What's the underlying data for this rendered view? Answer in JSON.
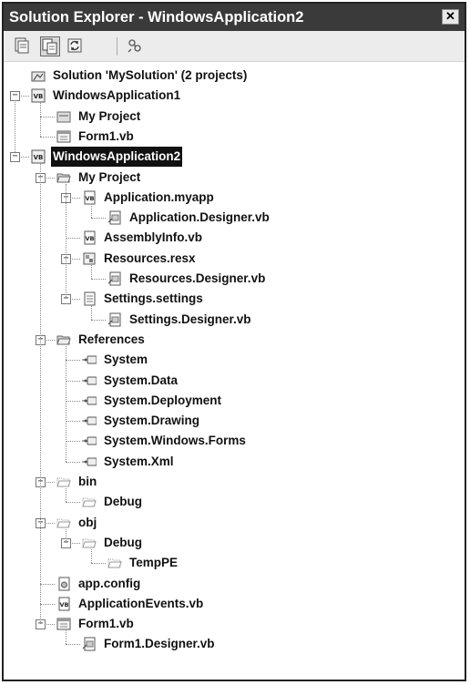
{
  "window": {
    "title": "Solution Explorer - WindowsApplication2",
    "close_glyph": "✕"
  },
  "toolbar": {
    "buttons": [
      {
        "name": "properties-button",
        "icon": "properties-icon",
        "active": false
      },
      {
        "name": "show-all-files-button",
        "icon": "show-all-files-icon",
        "active": true
      },
      {
        "name": "refresh-button",
        "icon": "refresh-icon",
        "active": false
      },
      {
        "name": "view-class-diagram-button",
        "icon": "class-diagram-icon",
        "active": false
      }
    ]
  },
  "tree": [
    {
      "label": "Solution 'MySolution' (2 projects)",
      "depth": 0,
      "icon": "solution-icon",
      "expander": "",
      "last": true
    },
    {
      "label": "WindowsApplication1",
      "depth": 0,
      "icon": "vb-project-icon",
      "expander": "-",
      "last": false
    },
    {
      "label": "My Project",
      "depth": 1,
      "icon": "my-project-icon",
      "expander": "",
      "last": false
    },
    {
      "label": "Form1.vb",
      "depth": 1,
      "icon": "form-icon",
      "expander": "",
      "last": true
    },
    {
      "label": "WindowsApplication2",
      "depth": 0,
      "icon": "vb-project-icon",
      "expander": "-",
      "last": true,
      "selected": true
    },
    {
      "label": "My Project",
      "depth": 1,
      "icon": "folder-open-icon",
      "expander": "-",
      "last": false
    },
    {
      "label": "Application.myapp",
      "depth": 2,
      "icon": "vb-file-icon",
      "expander": "-",
      "last": false
    },
    {
      "label": "Application.Designer.vb",
      "depth": 3,
      "icon": "designer-file-icon",
      "expander": "",
      "last": true
    },
    {
      "label": "AssemblyInfo.vb",
      "depth": 2,
      "icon": "vb-file-icon",
      "expander": "",
      "last": false
    },
    {
      "label": "Resources.resx",
      "depth": 2,
      "icon": "resx-icon",
      "expander": "-",
      "last": false
    },
    {
      "label": "Resources.Designer.vb",
      "depth": 3,
      "icon": "designer-file-icon",
      "expander": "",
      "last": true
    },
    {
      "label": "Settings.settings",
      "depth": 2,
      "icon": "settings-file-icon",
      "expander": "-",
      "last": true
    },
    {
      "label": "Settings.Designer.vb",
      "depth": 3,
      "icon": "designer-file-icon",
      "expander": "",
      "last": true
    },
    {
      "label": "References",
      "depth": 1,
      "icon": "folder-open-icon",
      "expander": "-",
      "last": false
    },
    {
      "label": "System",
      "depth": 2,
      "icon": "reference-icon",
      "expander": "",
      "last": false
    },
    {
      "label": "System.Data",
      "depth": 2,
      "icon": "reference-icon",
      "expander": "",
      "last": false
    },
    {
      "label": "System.Deployment",
      "depth": 2,
      "icon": "reference-icon",
      "expander": "",
      "last": false
    },
    {
      "label": "System.Drawing",
      "depth": 2,
      "icon": "reference-icon",
      "expander": "",
      "last": false
    },
    {
      "label": "System.Windows.Forms",
      "depth": 2,
      "icon": "reference-icon",
      "expander": "",
      "last": false
    },
    {
      "label": "System.Xml",
      "depth": 2,
      "icon": "reference-icon",
      "expander": "",
      "last": true
    },
    {
      "label": "bin",
      "depth": 1,
      "icon": "folder-hidden-icon",
      "expander": "-",
      "last": false
    },
    {
      "label": "Debug",
      "depth": 2,
      "icon": "folder-hidden-icon",
      "expander": "",
      "last": true
    },
    {
      "label": "obj",
      "depth": 1,
      "icon": "folder-hidden-icon",
      "expander": "-",
      "last": false
    },
    {
      "label": "Debug",
      "depth": 2,
      "icon": "folder-hidden-icon",
      "expander": "-",
      "last": true
    },
    {
      "label": "TempPE",
      "depth": 3,
      "icon": "folder-hidden-icon",
      "expander": "",
      "last": true
    },
    {
      "label": "app.config",
      "depth": 1,
      "icon": "config-file-icon",
      "expander": "",
      "last": false
    },
    {
      "label": "ApplicationEvents.vb",
      "depth": 1,
      "icon": "vb-file-icon",
      "expander": "",
      "last": false
    },
    {
      "label": "Form1.vb",
      "depth": 1,
      "icon": "form-icon",
      "expander": "-",
      "last": true
    },
    {
      "label": "Form1.Designer.vb",
      "depth": 2,
      "icon": "designer-file-icon",
      "expander": "",
      "last": true
    }
  ]
}
